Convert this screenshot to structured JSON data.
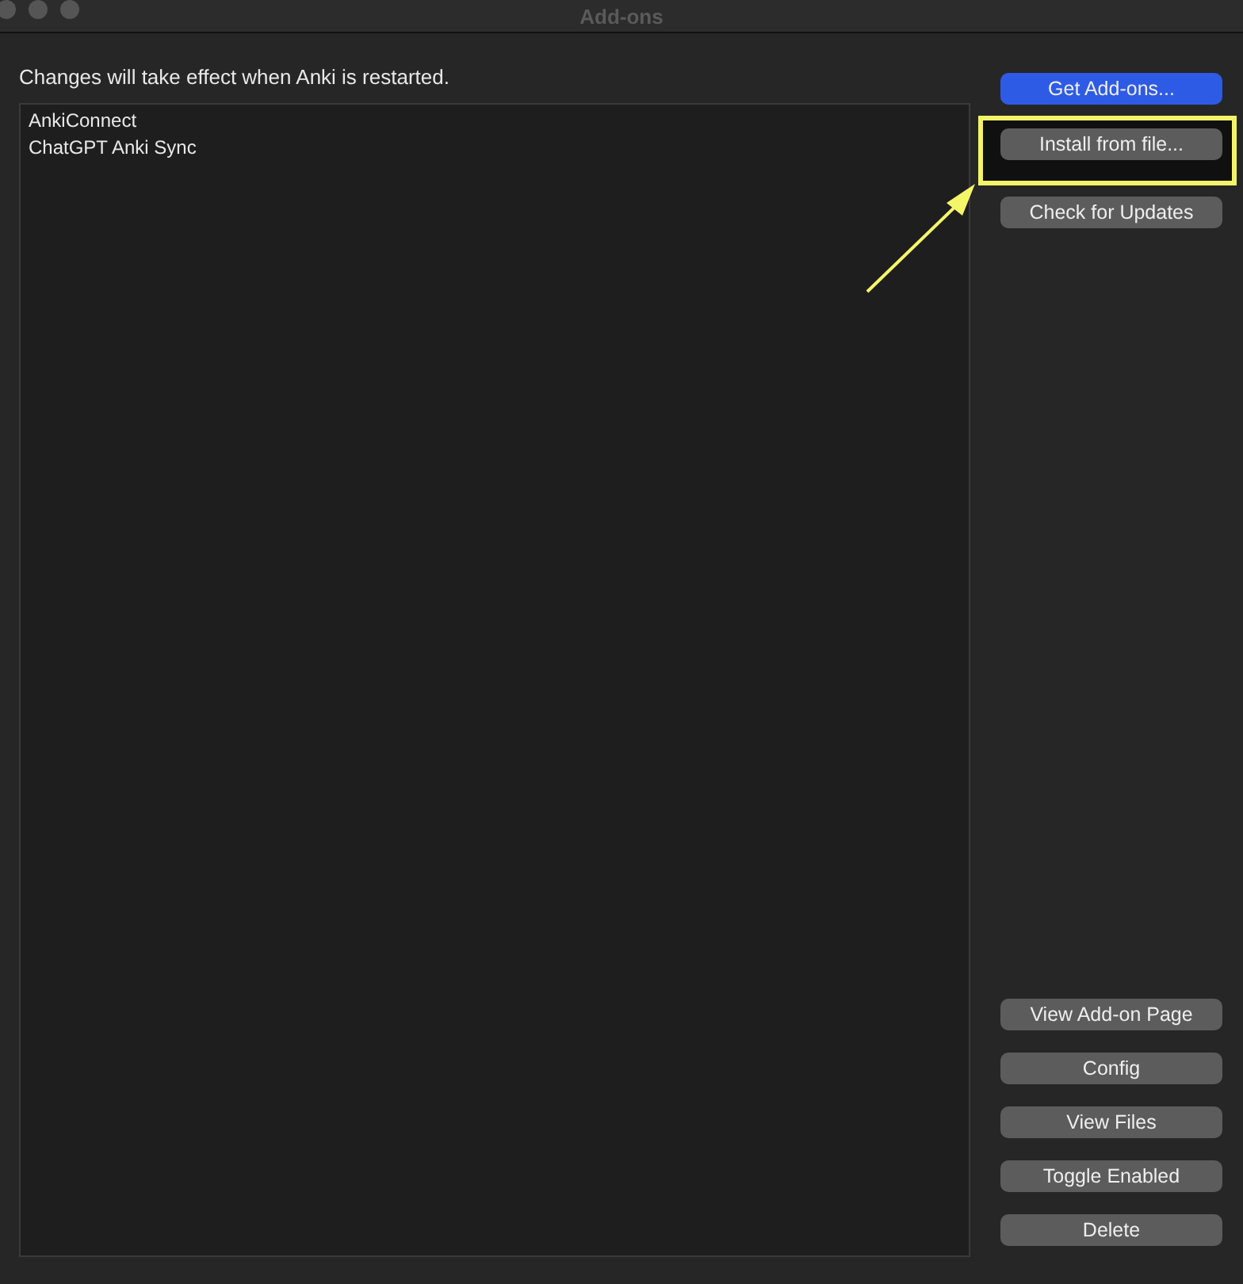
{
  "window": {
    "title": "Add-ons"
  },
  "notice": "Changes will take effect when Anki is restarted.",
  "addons": [
    {
      "name": "AnkiConnect",
      "selected": false
    },
    {
      "name": "ChatGPT Anki Sync",
      "selected": false
    }
  ],
  "top_buttons": [
    {
      "label": "Get Add-ons...",
      "kind": "primary",
      "highlighted": false
    },
    {
      "label": "Install from file...",
      "kind": "normal",
      "highlighted": true
    },
    {
      "label": "Check for Updates",
      "kind": "normal",
      "highlighted": false
    }
  ],
  "bottom_buttons": [
    {
      "label": "View Add-on Page"
    },
    {
      "label": "Config"
    },
    {
      "label": "View Files"
    },
    {
      "label": "Toggle Enabled"
    },
    {
      "label": "Delete"
    }
  ]
}
